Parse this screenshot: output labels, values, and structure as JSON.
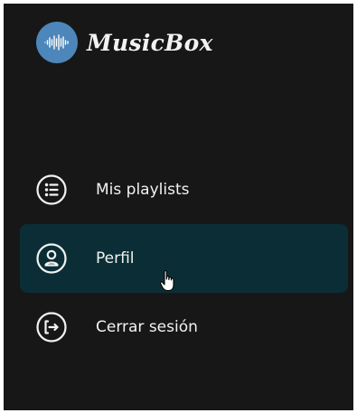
{
  "brand": {
    "name": "MusicBox",
    "logo_icon": "sound-wave-icon",
    "logo_color": "#4d86ba"
  },
  "nav": {
    "items": [
      {
        "label": "Mis playlists",
        "icon": "list-icon",
        "active": false
      },
      {
        "label": "Perfil",
        "icon": "user-icon",
        "active": true
      },
      {
        "label": "Cerrar sesión",
        "icon": "logout-icon",
        "active": false
      }
    ]
  },
  "colors": {
    "background": "#171717",
    "active_item": "#0b2e36",
    "text": "#f2f2f2"
  }
}
